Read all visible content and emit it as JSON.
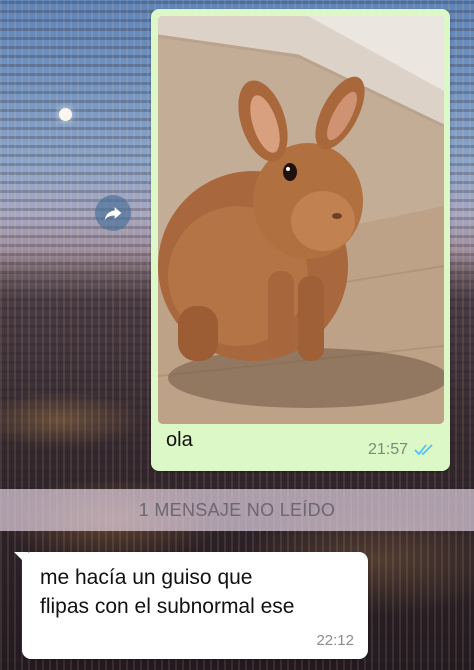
{
  "outgoing_message": {
    "photo_icon": "rabbit-photo",
    "text": "ola",
    "time": "21:57",
    "status_icon": "double-check-read-icon",
    "bubble_color": "#dcf8c6",
    "tick_color": "#4fc3f7"
  },
  "unread_banner": {
    "text": "1 MENSAJE NO LEÍDO"
  },
  "incoming_message": {
    "line1": "me hacía un guiso que",
    "line2": "flipas con el subnormal ese",
    "time": "22:12",
    "bubble_color": "#ffffff"
  },
  "forward_button": {
    "icon": "forward-arrow-icon"
  }
}
